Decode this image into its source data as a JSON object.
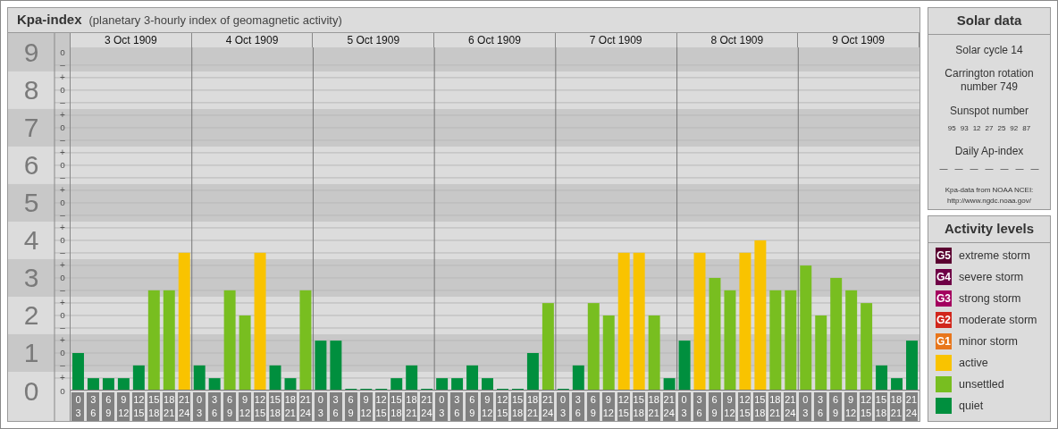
{
  "main_panel": {
    "title": "Kpa-index",
    "subtitle": "(planetary 3-hourly index of geomagnetic activity)",
    "days": [
      "3 Oct 1909",
      "4 Oct 1909",
      "5 Oct 1909",
      "6 Oct 1909",
      "7 Oct 1909",
      "8 Oct 1909",
      "9 Oct 1909"
    ],
    "sub_ticks": [
      "o",
      "–",
      "+",
      "o",
      "–",
      "+",
      "o",
      "–",
      "+",
      "o",
      "–",
      "+",
      "o",
      "–",
      "+",
      "o",
      "–",
      "+",
      "o",
      "–",
      "+",
      "o",
      "–",
      "+",
      "o",
      "–",
      "+",
      "o"
    ],
    "chart_data": {
      "type": "bar",
      "grid": true,
      "ylim": [
        0,
        9.14
      ],
      "yticks": [
        0,
        1,
        2,
        3,
        4,
        5,
        6,
        7,
        8,
        9
      ],
      "categories": [
        "0 3",
        "3 6",
        "6 9",
        "9 12",
        "12 15",
        "15 18",
        "18 21",
        "21 24",
        "0 3",
        "3 6",
        "6 9",
        "9 12",
        "12 15",
        "15 18",
        "18 21",
        "21 24",
        "0 3",
        "3 6",
        "6 9",
        "9 12",
        "12 15",
        "15 18",
        "18 21",
        "21 24",
        "0 3",
        "3 6",
        "6 9",
        "9 12",
        "12 15",
        "15 18",
        "18 21",
        "21 24",
        "0 3",
        "3 6",
        "6 9",
        "9 12",
        "12 15",
        "15 18",
        "18 21",
        "21 24",
        "0 3",
        "3 6",
        "6 9",
        "9 12",
        "12 15",
        "15 18",
        "18 21",
        "21 24",
        "0 3",
        "3 6",
        "6 9",
        "9 12",
        "12 15",
        "15 18",
        "18 21",
        "21 24"
      ],
      "series": [
        {
          "color": "#008f3e",
          "values": [
            1,
            0.33,
            0.33,
            0.33,
            0.67,
            null,
            null,
            null,
            0.67,
            0.33,
            null,
            null,
            null,
            0.67,
            0.33,
            null,
            1.33,
            1.33,
            0,
            0,
            0,
            0.33,
            0.67,
            0,
            0.33,
            0.33,
            0.67,
            0.33,
            0,
            0,
            1,
            null,
            0,
            0.67,
            null,
            null,
            null,
            null,
            null,
            0.33,
            1.33,
            null,
            null,
            null,
            null,
            null,
            null,
            null,
            null,
            null,
            null,
            null,
            null,
            0.67,
            0.33,
            1.33
          ]
        },
        {
          "color": "#78be20",
          "values": [
            null,
            null,
            null,
            null,
            null,
            2.67,
            2.67,
            null,
            null,
            null,
            2.67,
            2,
            null,
            null,
            null,
            2.67,
            null,
            null,
            null,
            null,
            null,
            null,
            null,
            null,
            null,
            null,
            null,
            null,
            null,
            null,
            null,
            2.33,
            null,
            null,
            2.33,
            2,
            null,
            null,
            2,
            null,
            null,
            null,
            3,
            2.67,
            null,
            null,
            2.67,
            2.67,
            3.33,
            2,
            3,
            2.67,
            2.33,
            null,
            null,
            null
          ]
        },
        {
          "color": "#f9c300",
          "values": [
            null,
            null,
            null,
            null,
            null,
            null,
            null,
            3.67,
            null,
            null,
            null,
            null,
            3.67,
            null,
            null,
            null,
            null,
            null,
            null,
            null,
            null,
            null,
            null,
            null,
            null,
            null,
            null,
            null,
            null,
            null,
            null,
            null,
            null,
            null,
            null,
            null,
            3.67,
            3.67,
            null,
            null,
            null,
            3.67,
            null,
            null,
            3.67,
            4,
            null,
            null,
            null,
            null,
            null,
            null,
            null,
            null,
            null,
            null
          ]
        }
      ]
    }
  },
  "solar_data": {
    "title": "Solar data",
    "solar_cycle": "Solar cycle 14",
    "carrington": "Carrington rotation number 749",
    "sunspot_label": "Sunspot number",
    "sunspot_numbers": [
      "95",
      "93",
      "12",
      "27",
      "25",
      "92",
      "87"
    ],
    "ap_label": "Daily Ap-index",
    "ap_values": [
      "—",
      "—",
      "—",
      "—",
      "—",
      "—",
      "—"
    ],
    "source_label": "Kpa-data from NOAA NCEI:",
    "source_url": "http://www.ngdc.noaa.gov/"
  },
  "activity_levels": {
    "title": "Activity levels",
    "items": [
      {
        "badge": "G5",
        "label": "extreme storm",
        "color": "#5a0030"
      },
      {
        "badge": "G4",
        "label": "severe storm",
        "color": "#6e0046"
      },
      {
        "badge": "G3",
        "label": "strong storm",
        "color": "#a3005e"
      },
      {
        "badge": "G2",
        "label": "moderate storm",
        "color": "#d1261c"
      },
      {
        "badge": "G1",
        "label": "minor storm",
        "color": "#e8761c"
      },
      {
        "label": "active",
        "color": "#f9c300"
      },
      {
        "label": "unsettled",
        "color": "#78be20"
      },
      {
        "label": "quiet",
        "color": "#008f3e"
      }
    ]
  }
}
